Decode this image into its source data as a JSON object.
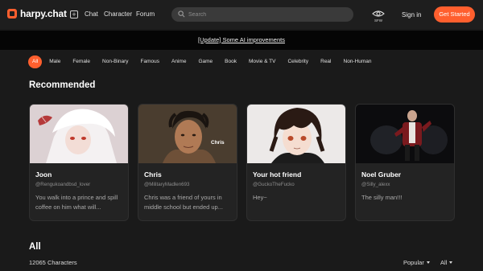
{
  "header": {
    "logo_text": "harpy.chat",
    "nav": [
      "Chat",
      "Character",
      "Forum"
    ],
    "search_placeholder": "Search",
    "sfw_label": "SFW",
    "signin": "Sign in",
    "get_started": "Get Started"
  },
  "banner": {
    "text": "[Update] Some AI improvements"
  },
  "filters": {
    "items": [
      "All",
      "Male",
      "Female",
      "Non-Binary",
      "Famous",
      "Anime",
      "Game",
      "Book",
      "Movie & TV",
      "Celebrity",
      "Real",
      "Non-Human"
    ],
    "active": "All"
  },
  "recommended": {
    "title": "Recommended",
    "cards": [
      {
        "name": "Joon",
        "handle": "@Rengukoandbsd_lover",
        "desc": "You walk into a prince and spill coffee on him what will..."
      },
      {
        "name": "Chris",
        "handle": "@MilitaryMadlen693",
        "desc": "Chris was a friend of yours in middle school but ended up...",
        "image_caption": "Chris"
      },
      {
        "name": "Your hot friend",
        "handle": "@GuckoTheFucko",
        "desc": "Hey~"
      },
      {
        "name": "Noel Gruber",
        "handle": "@Silly_alexx",
        "desc": "The silly man!!!"
      }
    ]
  },
  "all_section": {
    "title": "All",
    "count": "12065 Characters",
    "sort_label": "Popular",
    "filter_label": "All"
  },
  "colors": {
    "accent": "#ff5f2e",
    "background": "#1a1a1a",
    "card": "#232323"
  }
}
